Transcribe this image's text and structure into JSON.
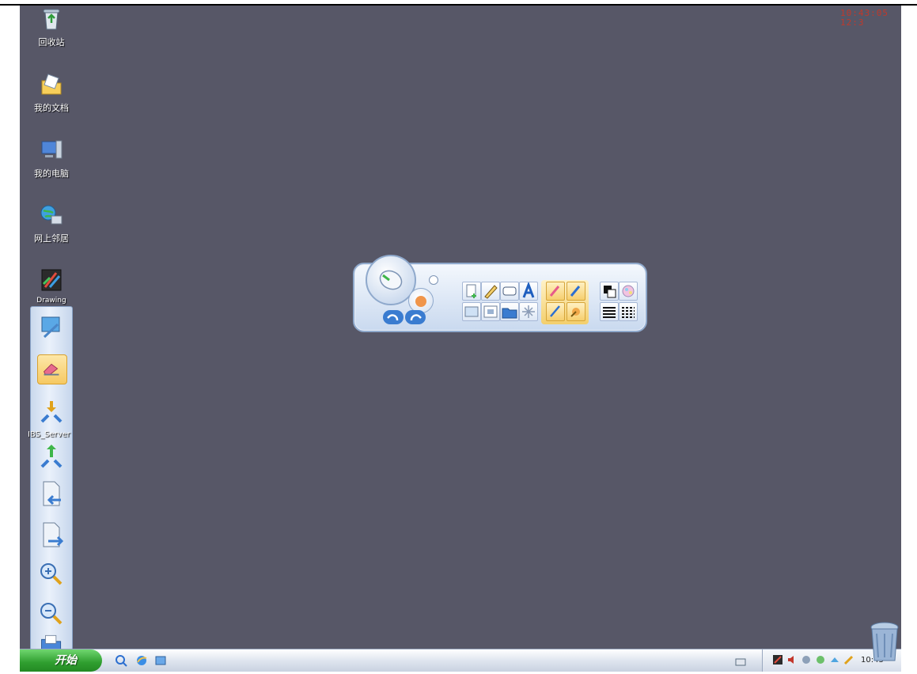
{
  "clock": {
    "time": "10:43:05",
    "sub": "12:3"
  },
  "desktop_icons": [
    {
      "label": "回收站",
      "icon": "recycle-bin-icon"
    },
    {
      "label": "我的文档",
      "icon": "my-documents-icon"
    },
    {
      "label": "我的电脑",
      "icon": "my-computer-icon"
    },
    {
      "label": "网上邻居",
      "icon": "network-neighborhood-icon"
    },
    {
      "label": "Drawing",
      "icon": "drawing-app-icon"
    }
  ],
  "under_text": {
    "net_server": "IBS_Server"
  },
  "vertical_toolbar": [
    {
      "icon": "screen-capture-icon"
    },
    {
      "icon": "eraser-icon",
      "active": true
    },
    {
      "icon": "download-arrows-icon"
    },
    {
      "icon": "upload-arrows-icon"
    },
    {
      "icon": "previous-page-icon"
    },
    {
      "icon": "next-page-icon"
    },
    {
      "icon": "zoom-in-icon"
    },
    {
      "icon": "zoom-out-icon"
    },
    {
      "icon": "open-folder-icon"
    }
  ],
  "floating_toolbar": {
    "tools_row1": [
      "insert-page-icon",
      "pen-icon",
      "rectangle-icon",
      "text-icon"
    ],
    "tools_row2": [
      "image-icon",
      "photo-icon",
      "folder-icon",
      "magic-icon"
    ],
    "pen_tools": [
      "highlighter-icon",
      "marker-icon",
      "pencil-icon",
      "brush-icon"
    ],
    "style_tools": [
      "fill-color-icon",
      "color-palette-icon",
      "line-thin-icon",
      "line-dashed-icon"
    ]
  },
  "taskbar": {
    "start_label": "开始",
    "quicklaunch": [
      "search-icon",
      "ie-icon",
      "show-desktop-icon"
    ],
    "tray_time": "10:43"
  },
  "colors": {
    "desktop": "#575767",
    "clock": "#c0392b",
    "start": "#2f9e2f"
  }
}
